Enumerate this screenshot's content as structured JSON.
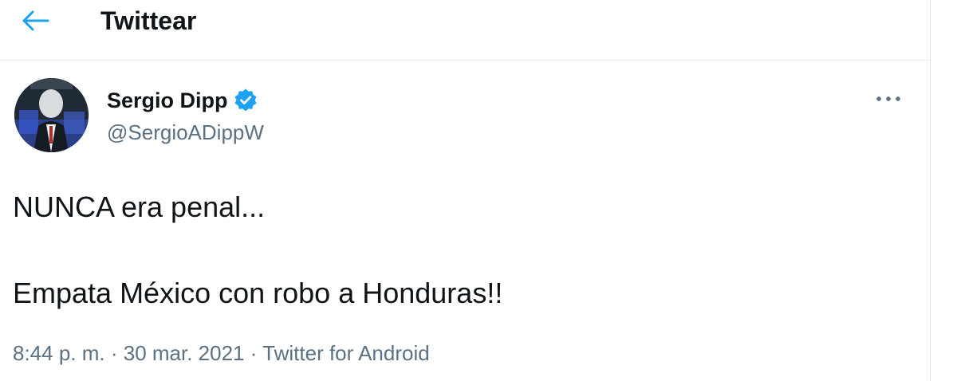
{
  "header": {
    "title": "Twittear",
    "back_icon": "arrow-left-icon"
  },
  "tweet": {
    "author": {
      "name": "Sergio Dipp",
      "handle": "@SergioADippW",
      "verified_icon": "verified-badge-icon"
    },
    "lines": [
      "NUNCA era penal...",
      "Empata México con robo a Honduras!!"
    ],
    "meta": {
      "time": "8:44 p. m.",
      "separator1": " · ",
      "date": "30 mar. 2021",
      "separator2": " · ",
      "source": "Twitter for Android"
    },
    "more_icon": "more-options-icon"
  },
  "colors": {
    "accent": "#1da1f2",
    "text": "#0f1419",
    "secondary_text": "#5b7083",
    "border": "#e6ecf0"
  }
}
